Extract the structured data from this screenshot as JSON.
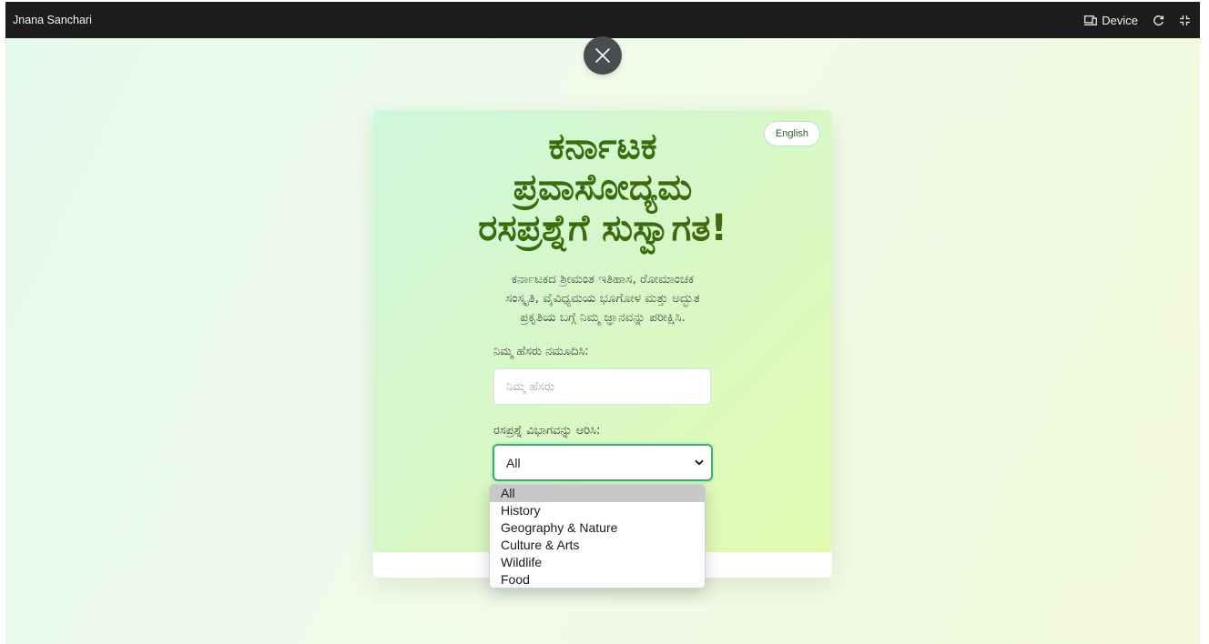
{
  "window": {
    "app_title": "Jnana Sanchari",
    "device_label": "Device",
    "icons": [
      "device-icon",
      "refresh-icon",
      "fullscreen-icon",
      "close-icon",
      "chevron-down-icon"
    ]
  },
  "colors": {
    "title_green": "#3a6b0e",
    "select_border": "#3fae72",
    "topbar_bg": "#1c1c1c",
    "close_button_bg": "#4a4d50"
  },
  "card": {
    "language_button": "English",
    "title_lines": [
      "ಕರ್ನಾಟಕ",
      "ಪ್ರವಾಸೋದ್ಯಮ",
      "ರಸಪ್ರಶ್ನೆಗೆ ಸುಸ್ವಾಗತ!"
    ],
    "subtitle_lines": [
      "ಕರ್ನಾಟಕದ ಶ್ರೀಮಂತ ಇತಿಹಾಸ, ರೋಮಾಂಚಕ",
      "ಸಂಸ್ಕೃತಿ, ವೈವಿಧ್ಯಮಯ ಭೂಗೋಳ ಮತ್ತು ಅದ್ಭುತ",
      "ಪ್ರಕೃತಿಯ ಬಗ್ಗೆ ನಿಮ್ಮ ಜ್ಞಾನವನ್ನು ಪರೀಕ್ಷಿಸಿ."
    ],
    "name_label": "ನಿಮ್ಮ ಹೆಸರು ನಮೂದಿಸಿ:",
    "name_placeholder": "ನಿಮ್ಮ ಹೆಸರು",
    "name_value": "",
    "category_label": "ರಸಪ್ರಶ್ನೆ ವಿಭಾಗವನ್ನು ಆರಿಸಿ:",
    "category_selected": "All"
  },
  "dropdown": {
    "options": [
      "All",
      "History",
      "Geography & Nature",
      "Culture & Arts",
      "Wildlife",
      "Food"
    ]
  }
}
